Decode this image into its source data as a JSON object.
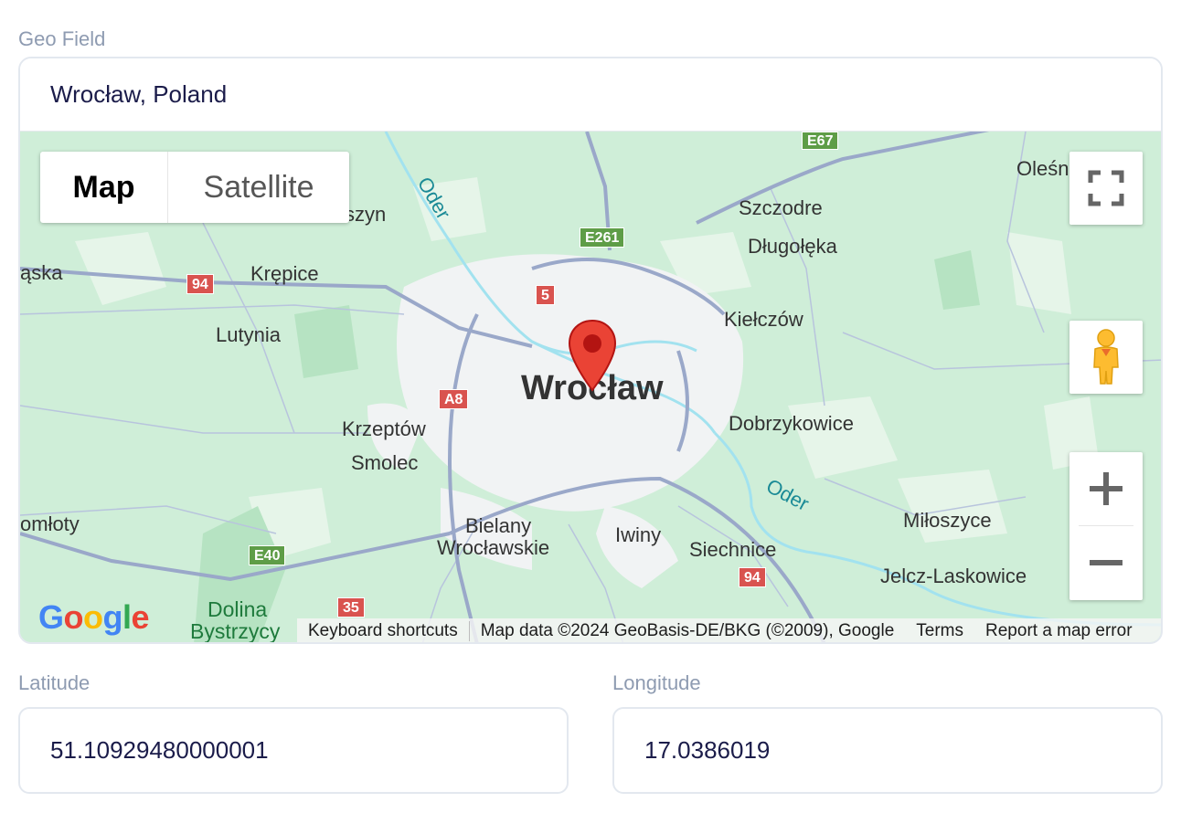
{
  "geo_field": {
    "label": "Geo Field",
    "value": "Wrocław, Poland"
  },
  "map": {
    "type_controls": {
      "map_label": "Map",
      "satellite_label": "Satellite",
      "selected": "Map"
    },
    "places": [
      {
        "name": "Wrocław",
        "kind": "city"
      },
      {
        "name": "Oleśn",
        "kind": "town"
      },
      {
        "name": "Szczodre",
        "kind": "town"
      },
      {
        "name": "Długołęka",
        "kind": "town"
      },
      {
        "name": "Kiełczów",
        "kind": "town"
      },
      {
        "name": "Krępice",
        "kind": "town"
      },
      {
        "name": "Lutynia",
        "kind": "town"
      },
      {
        "name": "kszyn",
        "kind": "town"
      },
      {
        "name": "ąska",
        "kind": "town"
      },
      {
        "name": "Krzeptów",
        "kind": "town"
      },
      {
        "name": "Smolec",
        "kind": "town"
      },
      {
        "name": "Dobrzykowice",
        "kind": "town"
      },
      {
        "name": "omłoty",
        "kind": "town"
      },
      {
        "name": "Bielany",
        "kind": "town"
      },
      {
        "name": "Wrocławskie",
        "kind": "town"
      },
      {
        "name": "Iwiny",
        "kind": "town"
      },
      {
        "name": "Siechnice",
        "kind": "town"
      },
      {
        "name": "Miłoszyce",
        "kind": "town"
      },
      {
        "name": "Jelcz-Laskowice",
        "kind": "town"
      },
      {
        "name": "Dolina",
        "kind": "park"
      },
      {
        "name": "Bystrzycy",
        "kind": "park"
      }
    ],
    "rivers": [
      "Oder",
      "Oder"
    ],
    "road_shields": [
      {
        "label": "E67",
        "color": "#5e9d47"
      },
      {
        "label": "E261",
        "color": "#5e9d47"
      },
      {
        "label": "E40",
        "color": "#5e9d47"
      },
      {
        "label": "94",
        "color": "#d9534f"
      },
      {
        "label": "5",
        "color": "#d9534f"
      },
      {
        "label": "A8",
        "color": "#d9534f"
      },
      {
        "label": "94",
        "color": "#d9534f"
      },
      {
        "label": "35",
        "color": "#d9534f"
      }
    ],
    "attribution": {
      "keyboard": "Keyboard shortcuts",
      "data": "Map data ©2024 GeoBasis-DE/BKG (©2009), Google",
      "terms": "Terms",
      "report": "Report a map error"
    },
    "logo": "Google",
    "icons": {
      "fullscreen": "fullscreen-icon",
      "pegman": "pegman-icon",
      "zoom_in": "plus-icon",
      "zoom_out": "minus-icon",
      "marker": "map-pin-icon"
    },
    "colors": {
      "land": "#cfeed8",
      "urban": "#f1f3f4",
      "roads": "#9aa8c9",
      "water": "#a2e2ef",
      "marker": "#ea4335"
    }
  },
  "latitude": {
    "label": "Latitude",
    "value": "51.10929480000001"
  },
  "longitude": {
    "label": "Longitude",
    "value": "17.0386019"
  }
}
